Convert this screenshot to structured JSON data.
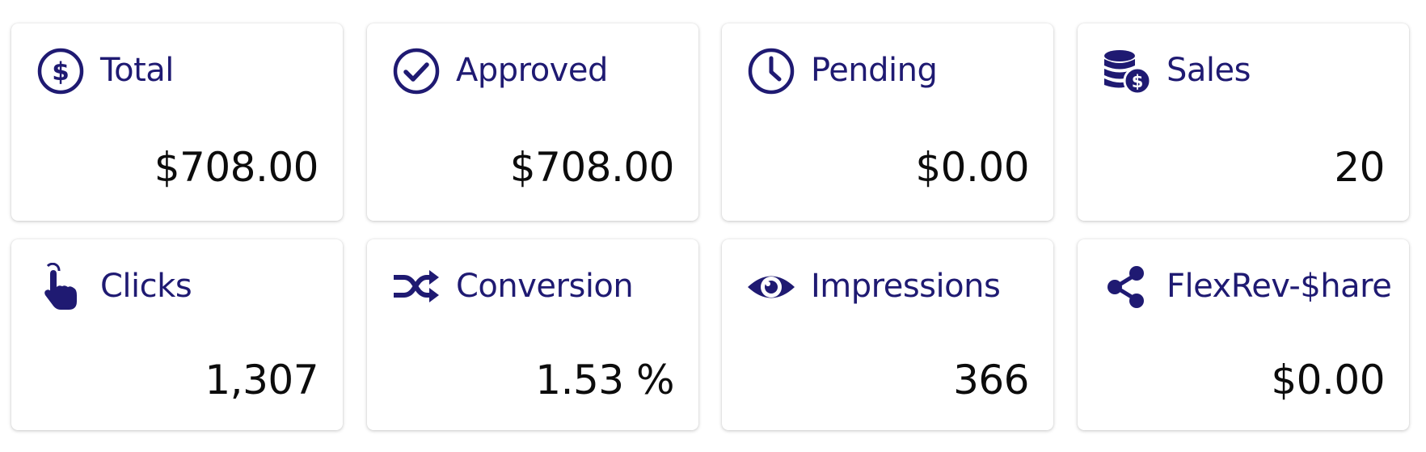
{
  "colors": {
    "accent": "#1f1a72",
    "value_text": "#0c0c0c",
    "card_bg": "#ffffff"
  },
  "cards": [
    {
      "label": "Total",
      "value": "$708.00",
      "icon": "dollar-circle-icon"
    },
    {
      "label": "Approved",
      "value": "$708.00",
      "icon": "check-circle-icon"
    },
    {
      "label": "Pending",
      "value": "$0.00",
      "icon": "clock-icon"
    },
    {
      "label": "Sales",
      "value": "20",
      "icon": "coins-dollar-icon"
    },
    {
      "label": "Clicks",
      "value": "1,307",
      "icon": "pointer-hand-icon"
    },
    {
      "label": "Conversion",
      "value": "1.53 %",
      "icon": "shuffle-icon"
    },
    {
      "label": "Impressions",
      "value": "366",
      "icon": "eye-icon"
    },
    {
      "label": "FlexRev-$hare",
      "value": "$0.00",
      "icon": "share-icon"
    }
  ]
}
